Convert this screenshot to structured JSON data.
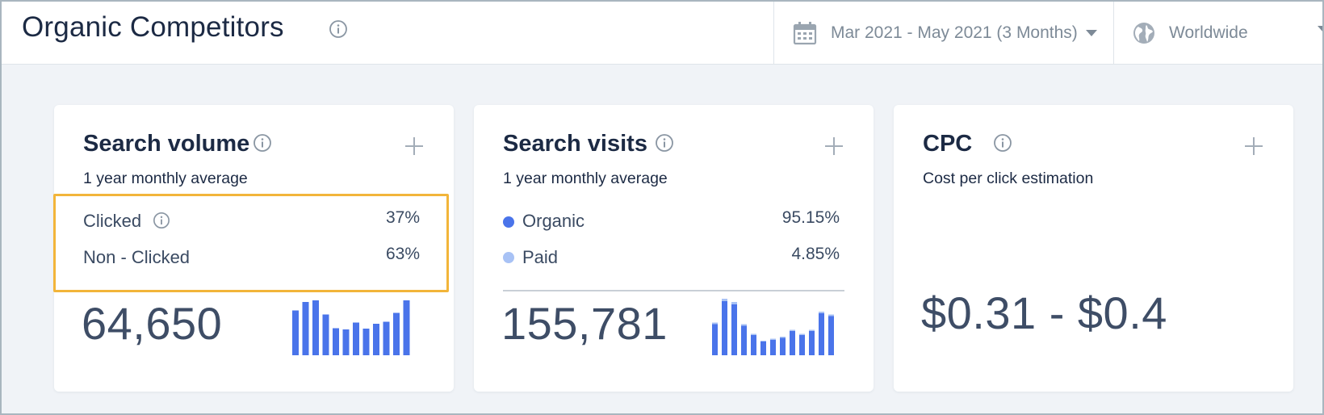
{
  "header": {
    "title": "Organic Competitors",
    "date_range": "Mar 2021 - May 2021 (3 Months)",
    "region": "Worldwide"
  },
  "colors": {
    "accent": "#4a74ea",
    "accent_light": "#a8c2f5",
    "highlight": "#f2b53a",
    "text_dark": "#1c2a44"
  },
  "cards": [
    {
      "title": "Search volume",
      "subtitle": "1 year monthly average",
      "rows": [
        {
          "label": "Clicked",
          "value": "37%"
        },
        {
          "label": "Non - Clicked",
          "value": "63%"
        }
      ],
      "big_number": "64,650",
      "sparkline": [
        0.79,
        0.94,
        0.97,
        0.72,
        0.48,
        0.46,
        0.58,
        0.47,
        0.56,
        0.59,
        0.75,
        0.97
      ]
    },
    {
      "title": "Search visits",
      "subtitle": "1 year monthly average",
      "rows": [
        {
          "label": "Organic",
          "value": "95.15%",
          "color": "#4a74ea"
        },
        {
          "label": "Paid",
          "value": "4.85%",
          "color": "#a8c2f5"
        }
      ],
      "big_number": "155,781",
      "sparkline": [
        {
          "organic": 0.55,
          "paid": 0.03
        },
        {
          "organic": 0.96,
          "paid": 0.04
        },
        {
          "organic": 0.9,
          "paid": 0.04
        },
        {
          "organic": 0.52,
          "paid": 0.03
        },
        {
          "organic": 0.36,
          "paid": 0.02
        },
        {
          "organic": 0.24,
          "paid": 0.02
        },
        {
          "organic": 0.27,
          "paid": 0.02
        },
        {
          "organic": 0.31,
          "paid": 0.02
        },
        {
          "organic": 0.43,
          "paid": 0.02
        },
        {
          "organic": 0.36,
          "paid": 0.02
        },
        {
          "organic": 0.43,
          "paid": 0.02
        },
        {
          "organic": 0.74,
          "paid": 0.03
        },
        {
          "organic": 0.69,
          "paid": 0.03
        }
      ]
    },
    {
      "title": "CPC",
      "subtitle": "Cost per click estimation",
      "big_number": "$0.31 - $0.4"
    }
  ],
  "icons": {
    "info": "info-icon",
    "add": "plus-icon",
    "calendar": "calendar-icon",
    "globe": "globe-icon",
    "dropdown": "chevron-down-icon"
  }
}
